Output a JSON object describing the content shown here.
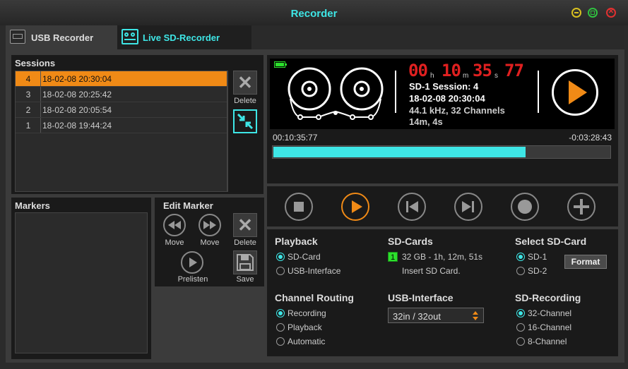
{
  "window": {
    "title": "Recorder"
  },
  "tabs": [
    {
      "label": "USB Recorder",
      "icon": "usb-recorder-icon"
    },
    {
      "label": "Live SD-Recorder",
      "icon": "tape-icon"
    }
  ],
  "sessions": {
    "title": "Sessions",
    "rows": [
      {
        "num": "4",
        "datetime": "18-02-08 20:30:04",
        "selected": true
      },
      {
        "num": "3",
        "datetime": "18-02-08 20:25:42",
        "selected": false
      },
      {
        "num": "2",
        "datetime": "18-02-08 20:05:54",
        "selected": false
      },
      {
        "num": "1",
        "datetime": "18-02-08 19:44:24",
        "selected": false
      }
    ],
    "delete_label": "Delete"
  },
  "markers": {
    "title": "Markers"
  },
  "edit_marker": {
    "title": "Edit Marker",
    "move_back_label": "Move",
    "move_fwd_label": "Move",
    "delete_label": "Delete",
    "prelisten_label": "Prelisten",
    "save_label": "Save"
  },
  "display": {
    "time_h": "00",
    "time_m": "10",
    "time_s": "35",
    "time_f": "77",
    "unit_h": "h",
    "unit_m": "m",
    "unit_s": "s",
    "session_line": "SD-1 Session: 4",
    "date_line": "18-02-08 20:30:04",
    "format_line": "44.1 kHz, 32 Channels",
    "length_line": "14m,  4s",
    "elapsed": "00:10:35:77",
    "remaining": "-0:03:28:43",
    "progress": 0.75
  },
  "playback": {
    "title": "Playback",
    "options": [
      "SD-Card",
      "USB-Interface"
    ],
    "selected": 0
  },
  "sdcards": {
    "title": "SD-Cards",
    "card_index": "1",
    "card1": "32 GB - 1h, 12m, 51s",
    "card2": "Insert SD Card."
  },
  "select_sd": {
    "title": "Select SD-Card",
    "options": [
      "SD-1",
      "SD-2"
    ],
    "selected": 0,
    "format_label": "Format"
  },
  "routing": {
    "title": "Channel Routing",
    "options": [
      "Recording",
      "Playback",
      "Automatic"
    ],
    "selected": 0
  },
  "usb_interface": {
    "title": "USB-Interface",
    "value": "32in / 32out"
  },
  "sd_recording": {
    "title": "SD-Recording",
    "options": [
      "32-Channel",
      "16-Channel",
      "8-Channel"
    ],
    "selected": 0
  },
  "colors": {
    "accent": "#3ee6e6",
    "selection": "#f08a16",
    "timecode": "#e02020"
  }
}
